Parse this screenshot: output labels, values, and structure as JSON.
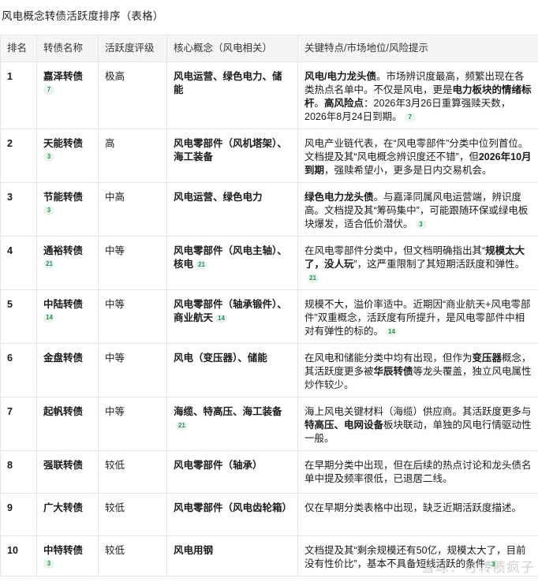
{
  "page_title": "风电概念转债活跃度排序（表格）",
  "table": {
    "headers": [
      "排名",
      "转债名称",
      "活跃度评级",
      "核心概念（风电相关）",
      "关键特点/市场地位/风险提示"
    ],
    "rows": [
      {
        "rank": "1",
        "name": "嘉泽转债",
        "name_badge": "7",
        "rating": "极高",
        "concept": "风电运营、绿色电力、储能",
        "concept_badge": "",
        "desc_parts": [
          {
            "t": "风电/电力龙头债",
            "b": true
          },
          {
            "t": "。市场辨识度最高，频繁出现在各类热点名单中。不仅是风电，更是",
            "b": false
          },
          {
            "t": "电力板块的情绪标杆",
            "b": true
          },
          {
            "t": "。",
            "b": false
          },
          {
            "t": "高风险点",
            "b": true
          },
          {
            "t": "：2026年3月26日重算强赎天数，2026年8月24日到期。",
            "b": false
          }
        ],
        "desc_badge": "7"
      },
      {
        "rank": "2",
        "name": "天能转债",
        "name_badge": "3",
        "rating": "高",
        "concept": "风电零部件（风机塔架）、海工装备",
        "concept_badge": "",
        "desc_parts": [
          {
            "t": "风电产业链代表，在“风电零部件”分类中位列首位。文档提及其“风电概念辨识度还不错”，但",
            "b": false
          },
          {
            "t": "2026年10月到期",
            "b": true
          },
          {
            "t": "，强赎希望小，更多是日内交易机会。",
            "b": false
          }
        ],
        "desc_badge": ""
      },
      {
        "rank": "3",
        "name": "节能转债",
        "name_badge": "3",
        "rating": "中高",
        "concept": "风电运营、绿色电力",
        "concept_badge": "",
        "desc_parts": [
          {
            "t": "绿色电力龙头债",
            "b": true
          },
          {
            "t": "。与嘉泽同属风电运营端，辨识度高。文档提及其“筹码集中”，可能跟随环保或绿电板块爆发，适合低价潜伏。",
            "b": false
          }
        ],
        "desc_badge": "3"
      },
      {
        "rank": "4",
        "name": "通裕转债",
        "name_badge": "21",
        "rating": "中等",
        "concept": "风电零部件（风电主轴）、核电",
        "concept_badge": "21",
        "desc_parts": [
          {
            "t": "在风电零部件分类中，但文档明确指出其“",
            "b": false
          },
          {
            "t": "规模太大了，没人玩",
            "b": true
          },
          {
            "t": "”，这严重限制了其短期活跃度和弹性。",
            "b": false
          }
        ],
        "desc_badge": "21"
      },
      {
        "rank": "5",
        "name": "中陆转债",
        "name_badge": "14",
        "rating": "中等",
        "concept": "风电零部件（轴承锻件）、商业航天",
        "concept_badge": "14",
        "desc_parts": [
          {
            "t": "规模不大，溢价率适中。近期因“商业航天+风电零部件”双重概念，活跃度有所提升，是风电零部件中相对有弹性的标的。",
            "b": false
          }
        ],
        "desc_badge": "14"
      },
      {
        "rank": "6",
        "name": "金盘转债",
        "name_badge": "",
        "rating": "中等",
        "concept": "风电（变压器）、储能",
        "concept_badge": "",
        "desc_parts": [
          {
            "t": "在风电和储能分类中均有出现，但作为",
            "b": false
          },
          {
            "t": "变压器",
            "b": true
          },
          {
            "t": "概念，其活跃度更多被",
            "b": false
          },
          {
            "t": "华辰转债",
            "b": true
          },
          {
            "t": "等龙头覆盖，独立风电属性炒作较少。",
            "b": false
          }
        ],
        "desc_badge": ""
      },
      {
        "rank": "7",
        "name": "起帆转债",
        "name_badge": "",
        "rating": "中等",
        "concept": "海缆、特高压、海工装备",
        "concept_badge": "21",
        "desc_parts": [
          {
            "t": "海上风电关键材料（海缆）供应商。其活跃度更多与",
            "b": false
          },
          {
            "t": "特高压、电网设备",
            "b": true
          },
          {
            "t": "板块联动，单独的风电行情驱动性一般。",
            "b": false
          }
        ],
        "desc_badge": ""
      },
      {
        "rank": "8",
        "name": "强联转债",
        "name_badge": "",
        "rating": "较低",
        "concept": "风电零部件（轴承）",
        "concept_badge": "",
        "desc_parts": [
          {
            "t": "在早期分类中出现，但在后续的热点讨论和龙头债名单中提及频率很低，已退居二线。",
            "b": false
          }
        ],
        "desc_badge": ""
      },
      {
        "rank": "9",
        "name": "广大转债",
        "name_badge": "",
        "rating": "较低",
        "concept": "风电零部件（风电齿轮箱）",
        "concept_badge": "",
        "desc_parts": [
          {
            "t": "仅在早期分类表格中出现，缺乏近期活跃度描述。",
            "b": false
          }
        ],
        "desc_badge": ""
      },
      {
        "rank": "10",
        "name": "中特转债",
        "name_badge": "3",
        "rating": "较低",
        "concept": "风电用钢",
        "concept_badge": "",
        "desc_parts": [
          {
            "t": "文档提及其“剩余规模还有50亿，规模太大了，目前没有性价比”，基本不具备短线活跃的条件",
            "b": false
          }
        ],
        "desc_badge": "3"
      }
    ]
  },
  "watermark": "雪球：可转债疯子"
}
